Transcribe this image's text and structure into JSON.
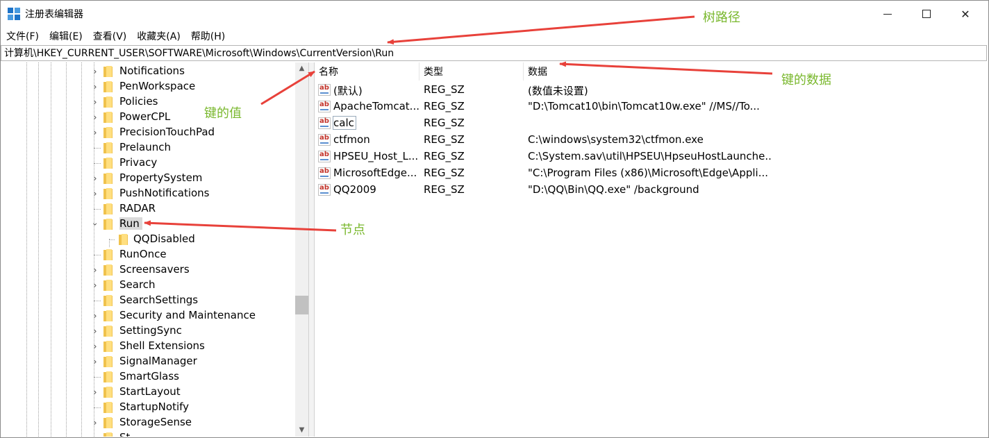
{
  "window": {
    "title": "注册表编辑器",
    "min_glyph": "",
    "close_glyph": "✕"
  },
  "menu": [
    "文件(F)",
    "编辑(E)",
    "查看(V)",
    "收藏夹(A)",
    "帮助(H)"
  ],
  "address": "计算机\\HKEY_CURRENT_USER\\SOFTWARE\\Microsoft\\Windows\\CurrentVersion\\Run",
  "tree": [
    {
      "label": "Notifications",
      "state": "collapsed"
    },
    {
      "label": "PenWorkspace",
      "state": "collapsed"
    },
    {
      "label": "Policies",
      "state": "collapsed"
    },
    {
      "label": "PowerCPL",
      "state": "collapsed"
    },
    {
      "label": "PrecisionTouchPad",
      "state": "collapsed"
    },
    {
      "label": "Prelaunch",
      "state": "leaf"
    },
    {
      "label": "Privacy",
      "state": "leaf"
    },
    {
      "label": "PropertySystem",
      "state": "collapsed"
    },
    {
      "label": "PushNotifications",
      "state": "collapsed"
    },
    {
      "label": "RADAR",
      "state": "leaf"
    },
    {
      "label": "Run",
      "state": "expanded",
      "selected": true
    },
    {
      "label": "QQDisabled",
      "state": "child"
    },
    {
      "label": "RunOnce",
      "state": "leaf"
    },
    {
      "label": "Screensavers",
      "state": "collapsed"
    },
    {
      "label": "Search",
      "state": "collapsed"
    },
    {
      "label": "SearchSettings",
      "state": "leaf"
    },
    {
      "label": "Security and Maintenance",
      "state": "collapsed"
    },
    {
      "label": "SettingSync",
      "state": "collapsed"
    },
    {
      "label": "Shell Extensions",
      "state": "collapsed"
    },
    {
      "label": "SignalManager",
      "state": "collapsed"
    },
    {
      "label": "SmartGlass",
      "state": "leaf"
    },
    {
      "label": "StartLayout",
      "state": "collapsed"
    },
    {
      "label": "StartupNotify",
      "state": "leaf"
    },
    {
      "label": "StorageSense",
      "state": "collapsed"
    },
    {
      "label": "St...",
      "state": "collapsed"
    }
  ],
  "list_columns": [
    "名称",
    "类型",
    "数据"
  ],
  "list_rows": [
    {
      "name": "(默认)",
      "type": "REG_SZ",
      "data": "(数值未设置)"
    },
    {
      "name": "ApacheTomcat...",
      "type": "REG_SZ",
      "data": "\"D:\\Tomcat10\\bin\\Tomcat10w.exe\" //MS//To..."
    },
    {
      "name": "calc",
      "type": "REG_SZ",
      "data": "",
      "focused": true
    },
    {
      "name": "ctfmon",
      "type": "REG_SZ",
      "data": "C:\\windows\\system32\\ctfmon.exe"
    },
    {
      "name": "HPSEU_Host_L...",
      "type": "REG_SZ",
      "data": "C:\\System.sav\\util\\HPSEU\\HpseuHostLaunche..."
    },
    {
      "name": "MicrosoftEdge...",
      "type": "REG_SZ",
      "data": "\"C:\\Program Files (x86)\\Microsoft\\Edge\\Appli..."
    },
    {
      "name": "QQ2009",
      "type": "REG_SZ",
      "data": "\"D:\\QQ\\Bin\\QQ.exe\" /background"
    }
  ],
  "annotations": {
    "tree_path": "树路径",
    "key_data": "键的数据",
    "key_value": "键的值",
    "node": "节点",
    "color": "#7ab82e",
    "arrow_color": "#e8413a"
  },
  "icons": {
    "app": "registry-grid-icon",
    "folder": "folder-icon",
    "value": "string-value-ab-icon"
  }
}
